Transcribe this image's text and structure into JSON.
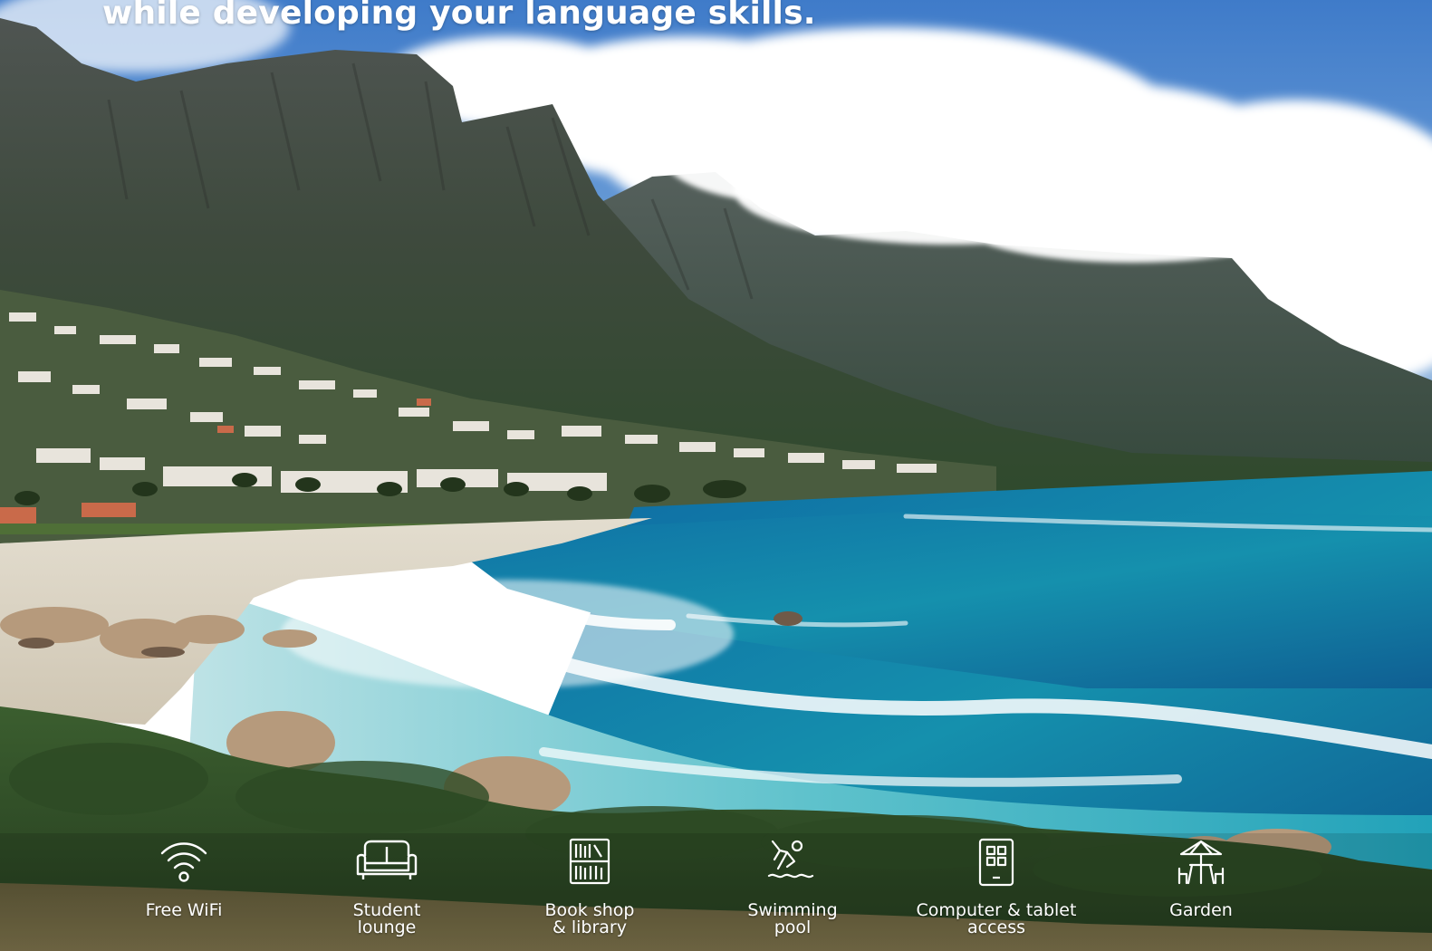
{
  "hero": {
    "headline": "while developing your language skills."
  },
  "amenities": [
    {
      "icon": "wifi-icon",
      "label": "Free WiFi"
    },
    {
      "icon": "sofa-icon",
      "label": "Student\nlounge"
    },
    {
      "icon": "bookshelf-icon",
      "label": "Book shop\n& library"
    },
    {
      "icon": "swimmer-icon",
      "label": "Swimming\npool"
    },
    {
      "icon": "tablet-icon",
      "label": "Computer & tablet\naccess"
    },
    {
      "icon": "garden-umbrella-icon",
      "label": "Garden"
    }
  ],
  "colors": {
    "sky": "#5a8fd0",
    "cloud": "#ffffff",
    "mountain": "#3b4a3a",
    "ocean_deep": "#0c5b96",
    "ocean_turquoise": "#1fa1b6",
    "sand": "#d9d3c4",
    "vegetation": "#2f4f27",
    "text": "#ffffff"
  }
}
